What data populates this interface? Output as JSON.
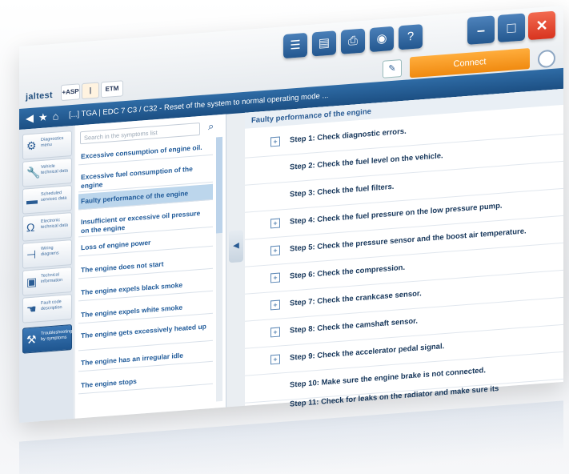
{
  "header": {
    "logo": "jaltest",
    "tabs": [
      "+ASP",
      "ETM"
    ],
    "tool_icons": [
      "list-icon",
      "clipboard-icon",
      "printer-icon",
      "camera-icon",
      "help-icon"
    ],
    "help_label": "?",
    "connect_label": "Connect"
  },
  "navbar": {
    "breadcrumb": "[...] TGA | EDC 7 C3 / C32 - Reset of the system to normal operating mode ..."
  },
  "sidebar": {
    "items": [
      {
        "label": "Diagnostics menu",
        "icon": "diagnostics-icon"
      },
      {
        "label": "Vehicle technical data",
        "icon": "wrench-icon"
      },
      {
        "label": "Scheduled services data",
        "icon": "service-icon"
      },
      {
        "label": "Electronic technical data",
        "icon": "ohm-icon"
      },
      {
        "label": "Wiring diagrams",
        "icon": "wiring-icon"
      },
      {
        "label": "Technical information",
        "icon": "book-icon"
      },
      {
        "label": "Fault code description",
        "icon": "hand-icon"
      },
      {
        "label": "Troubleshooting by symptoms",
        "icon": "troubleshoot-icon",
        "active": true
      }
    ]
  },
  "symptoms": {
    "search_placeholder": "Search in the symptoms list",
    "items": [
      "Excessive consumption of engine oil.",
      "Excessive fuel consumption of the engine",
      "Faulty performance of the engine",
      "Insufficient or excessive oil pressure on the engine",
      "Loss of engine power",
      "The engine does not start",
      "The engine expels black smoke",
      "The engine expels white smoke",
      "The engine gets excessively heated up",
      "The engine has an irregular idle",
      "The engine stops"
    ],
    "selected_index": 2
  },
  "content": {
    "title": "Faulty performance of the engine",
    "steps": [
      {
        "text": "Step 1: Check diagnostic errors.",
        "expandable": true
      },
      {
        "text": "Step 2: Check the fuel level on the vehicle.",
        "expandable": false
      },
      {
        "text": "Step 3: Check the fuel filters.",
        "expandable": false
      },
      {
        "text": "Step 4: Check the fuel pressure on the low pressure pump.",
        "expandable": true
      },
      {
        "text": "Step 5: Check the pressure sensor and the boost air temperature.",
        "expandable": true
      },
      {
        "text": "Step 6: Check the compression.",
        "expandable": true
      },
      {
        "text": "Step 7: Check the crankcase sensor.",
        "expandable": true
      },
      {
        "text": "Step 8: Check the camshaft sensor.",
        "expandable": true
      },
      {
        "text": "Step 9: Check the accelerator pedal signal.",
        "expandable": true
      },
      {
        "text": "Step 10: Make sure the engine brake is not connected.",
        "expandable": false
      },
      {
        "text": "Step 11: Check for leaks on the radiator and make sure its",
        "expandable": false
      }
    ]
  },
  "colors": {
    "accent_blue": "#1f5a99",
    "connect_orange": "#f39a1c",
    "close_red": "#e8412c",
    "selected_row": "#bcd6ec"
  }
}
